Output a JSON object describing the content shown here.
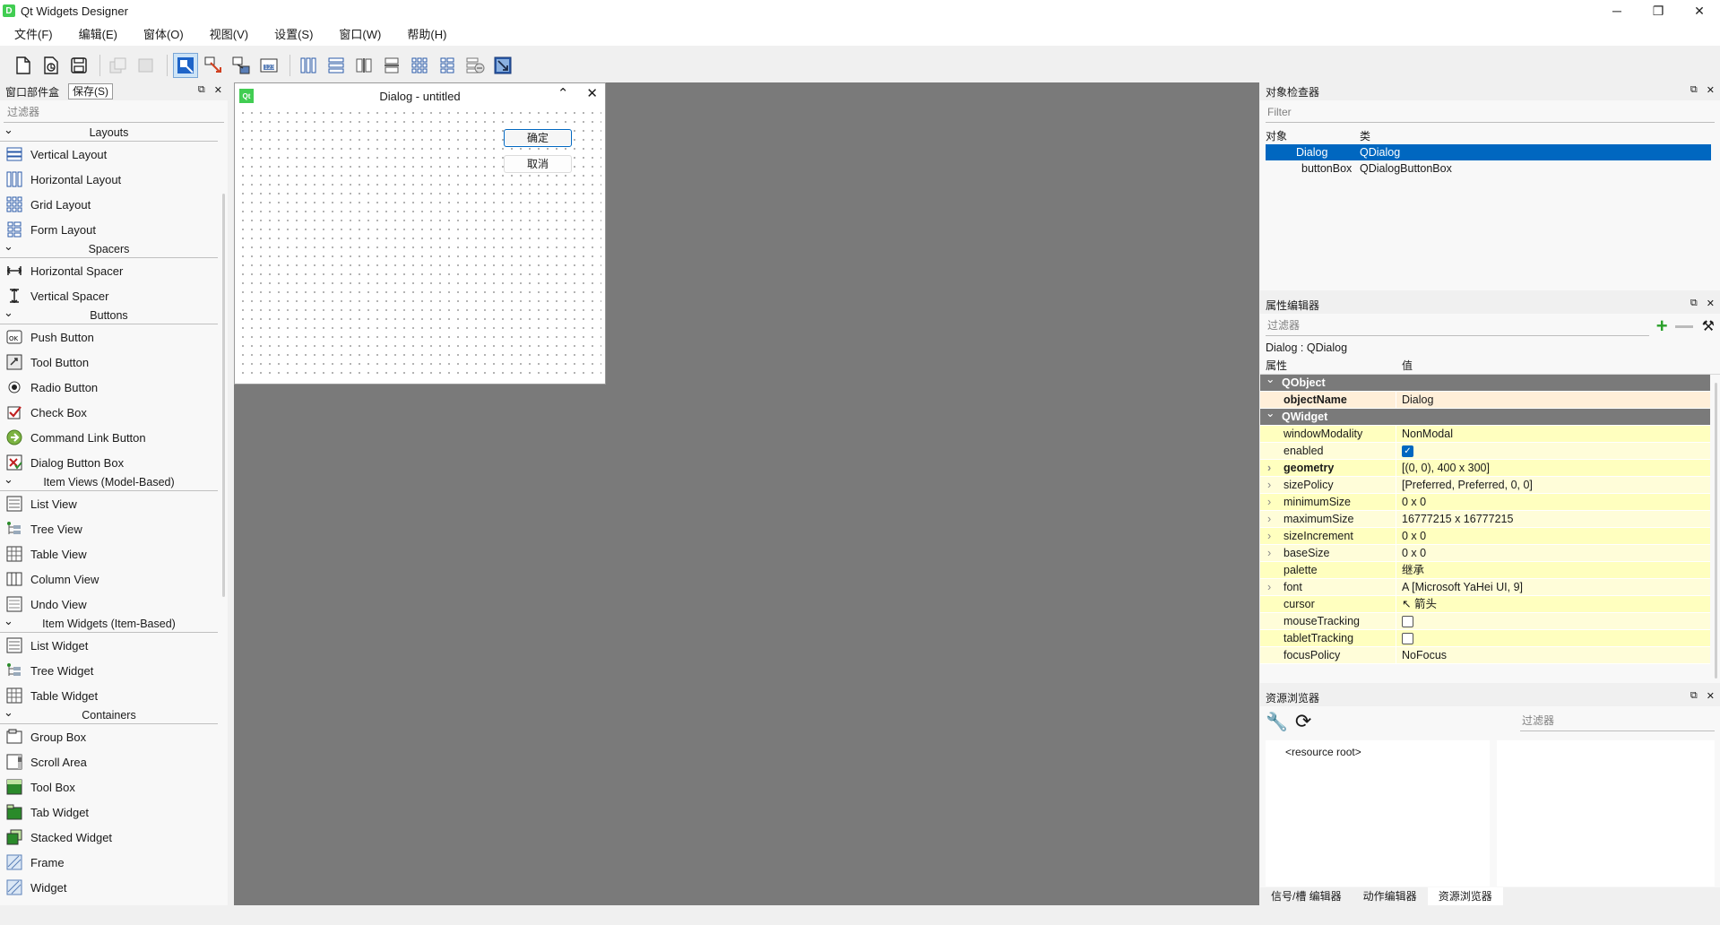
{
  "window": {
    "app_icon": "D",
    "title": "Qt Widgets Designer",
    "minimize": "─",
    "maximize": "❐",
    "close": "✕"
  },
  "menu": [
    "文件(F)",
    "编辑(E)",
    "窗体(O)",
    "视图(V)",
    "设置(S)",
    "窗口(W)",
    "帮助(H)"
  ],
  "widget_box": {
    "title": "窗口部件盒",
    "tooltip": "保存(S)",
    "filter_placeholder": "过滤器",
    "categories": [
      {
        "name": "Layouts",
        "items": [
          {
            "label": "Vertical Layout",
            "icon": "vertical-layout-icon"
          },
          {
            "label": "Horizontal Layout",
            "icon": "horizontal-layout-icon"
          },
          {
            "label": "Grid Layout",
            "icon": "grid-layout-icon"
          },
          {
            "label": "Form Layout",
            "icon": "form-layout-icon"
          }
        ]
      },
      {
        "name": "Spacers",
        "items": [
          {
            "label": "Horizontal Spacer",
            "icon": "horizontal-spacer-icon"
          },
          {
            "label": "Vertical Spacer",
            "icon": "vertical-spacer-icon"
          }
        ]
      },
      {
        "name": "Buttons",
        "items": [
          {
            "label": "Push Button",
            "icon": "push-button-icon"
          },
          {
            "label": "Tool Button",
            "icon": "tool-button-icon"
          },
          {
            "label": "Radio Button",
            "icon": "radio-button-icon"
          },
          {
            "label": "Check Box",
            "icon": "check-box-icon"
          },
          {
            "label": "Command Link Button",
            "icon": "command-link-icon"
          },
          {
            "label": "Dialog Button Box",
            "icon": "dialog-button-box-icon"
          }
        ]
      },
      {
        "name": "Item Views (Model-Based)",
        "items": [
          {
            "label": "List View",
            "icon": "list-view-icon"
          },
          {
            "label": "Tree View",
            "icon": "tree-view-icon"
          },
          {
            "label": "Table View",
            "icon": "table-view-icon"
          },
          {
            "label": "Column View",
            "icon": "column-view-icon"
          },
          {
            "label": "Undo View",
            "icon": "undo-view-icon"
          }
        ]
      },
      {
        "name": "Item Widgets (Item-Based)",
        "items": [
          {
            "label": "List Widget",
            "icon": "list-widget-icon"
          },
          {
            "label": "Tree Widget",
            "icon": "tree-widget-icon"
          },
          {
            "label": "Table Widget",
            "icon": "table-widget-icon"
          }
        ]
      },
      {
        "name": "Containers",
        "items": [
          {
            "label": "Group Box",
            "icon": "group-box-icon"
          },
          {
            "label": "Scroll Area",
            "icon": "scroll-area-icon"
          },
          {
            "label": "Tool Box",
            "icon": "tool-box-icon"
          },
          {
            "label": "Tab Widget",
            "icon": "tab-widget-icon"
          },
          {
            "label": "Stacked Widget",
            "icon": "stacked-widget-icon"
          },
          {
            "label": "Frame",
            "icon": "frame-icon"
          },
          {
            "label": "Widget",
            "icon": "widget-icon"
          }
        ]
      }
    ]
  },
  "form": {
    "icon": "Qt",
    "title": "Dialog - untitled",
    "ok_label": "确定",
    "cancel_label": "取消"
  },
  "object_inspector": {
    "title": "对象检查器",
    "filter_placeholder": "Filter",
    "col_object": "对象",
    "col_class": "类",
    "rows": [
      {
        "object": "Dialog",
        "class": "QDialog",
        "selected": true
      },
      {
        "object": "buttonBox",
        "class": "QDialogButtonBox",
        "selected": false
      }
    ]
  },
  "property_editor": {
    "title": "属性编辑器",
    "filter_placeholder": "过滤器",
    "object_label": "Dialog : QDialog",
    "col_property": "属性",
    "col_value": "值",
    "rows": [
      {
        "type": "group",
        "name": "QObject"
      },
      {
        "type": "o1",
        "name": "objectName",
        "value": "Dialog",
        "bold": true,
        "expand": false
      },
      {
        "type": "group",
        "name": "QWidget"
      },
      {
        "type": "y1",
        "name": "windowModality",
        "value": "NonModal",
        "bold": false,
        "expand": false
      },
      {
        "type": "y2",
        "name": "enabled",
        "value": "",
        "check": true,
        "bold": false,
        "expand": false
      },
      {
        "type": "y1",
        "name": "geometry",
        "value": "[(0, 0), 400 x 300]",
        "bold": true,
        "expand": true
      },
      {
        "type": "y2",
        "name": "sizePolicy",
        "value": "[Preferred, Preferred, 0, 0]",
        "bold": false,
        "expand": true
      },
      {
        "type": "y1",
        "name": "minimumSize",
        "value": "0 x 0",
        "bold": false,
        "expand": true
      },
      {
        "type": "y2",
        "name": "maximumSize",
        "value": "16777215 x 16777215",
        "bold": false,
        "expand": true
      },
      {
        "type": "y1",
        "name": "sizeIncrement",
        "value": "0 x 0",
        "bold": false,
        "expand": true
      },
      {
        "type": "y2",
        "name": "baseSize",
        "value": "0 x 0",
        "bold": false,
        "expand": true
      },
      {
        "type": "y1",
        "name": "palette",
        "value": "继承",
        "bold": false,
        "expand": false
      },
      {
        "type": "y2",
        "name": "font",
        "value": "A  [Microsoft YaHei UI, 9]",
        "bold": false,
        "expand": true
      },
      {
        "type": "y1",
        "name": "cursor",
        "value": "↖  箭头",
        "bold": false,
        "expand": false
      },
      {
        "type": "y2",
        "name": "mouseTracking",
        "value": "",
        "check": false,
        "bold": false,
        "expand": false
      },
      {
        "type": "y1",
        "name": "tabletTracking",
        "value": "",
        "check": false,
        "bold": false,
        "expand": false
      },
      {
        "type": "y2",
        "name": "focusPolicy",
        "value": "NoFocus",
        "bold": false,
        "expand": false
      }
    ]
  },
  "resource_browser": {
    "title": "资源浏览器",
    "filter_placeholder": "过滤器",
    "root": "<resource root>"
  },
  "bottom_tabs": [
    "信号/槽 编辑器",
    "动作编辑器",
    "资源浏览器"
  ]
}
